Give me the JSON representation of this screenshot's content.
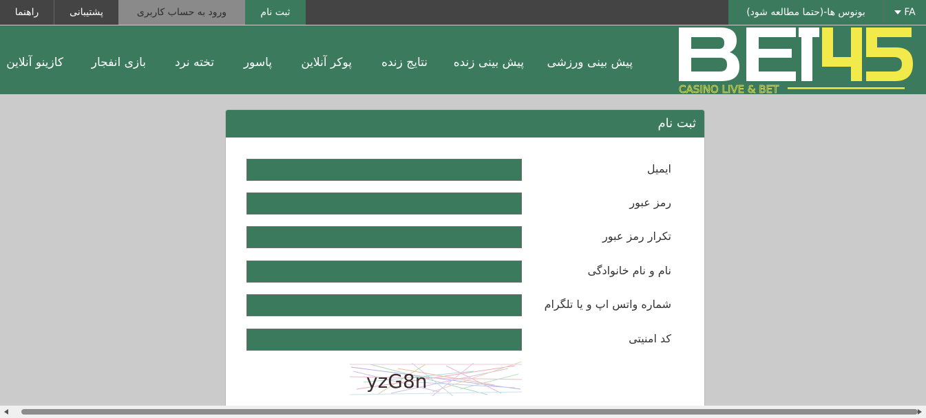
{
  "topbar": {
    "help": "راهنما",
    "support": "پشتیبانی",
    "login": "ورود به حساب کاربری",
    "register": "ثبت نام",
    "bonus": "بونوس ها-(حتما مطالعه شود)",
    "lang": "FA"
  },
  "logo": {
    "text_main": "BET",
    "text_num": "45",
    "tagline": "CASINO LIVE & BET",
    "colors": {
      "main": "#ffffff",
      "accent": "#f2e94a"
    }
  },
  "nav": {
    "items": [
      "پیش بینی ورزشی",
      "پیش بینی زنده",
      "نتایج زنده",
      "پوکر آنلاین",
      "پاسور",
      "تخته نرد",
      "بازی انفجار",
      "کازینو آنلاین"
    ]
  },
  "form": {
    "title": "ثبت نام",
    "fields": [
      {
        "label": "ایمیل",
        "value": ""
      },
      {
        "label": "رمز عبور",
        "value": ""
      },
      {
        "label": "تکرار رمز عبور",
        "value": ""
      },
      {
        "label": "نام و نام خانوادگی",
        "value": ""
      },
      {
        "label": "شماره واتس اپ و یا تلگرام",
        "value": ""
      },
      {
        "label": "کد امنیتی",
        "value": ""
      }
    ],
    "captcha_text": "yzG8n"
  },
  "colors": {
    "brand_green": "#3b7a5c",
    "topbar_dark": "#444444",
    "page_bg": "#cbcbcb"
  }
}
